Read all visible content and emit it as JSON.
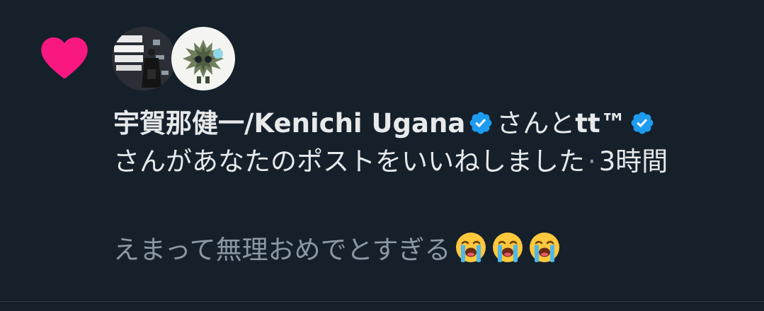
{
  "notification": {
    "user1_name": "宇賀那健一/Kenichi Ugana",
    "connector": "さんと",
    "user2_name": "tt™",
    "action_text": "さんがあなたのポストをいいねしました",
    "separator": "·",
    "time_ago": "3時間",
    "post_preview": "えまって無理おめでとすぎる",
    "emoji_count": 3
  },
  "colors": {
    "background": "#15202b",
    "heart": "#f91880",
    "verified": "#1d9bf0",
    "primary_text": "#e7e9ea",
    "secondary_text": "#8b98a5"
  },
  "icons": {
    "like": "heart-icon",
    "verified": "verified-badge-icon",
    "emoji": "loudly-crying-face-emoji"
  }
}
